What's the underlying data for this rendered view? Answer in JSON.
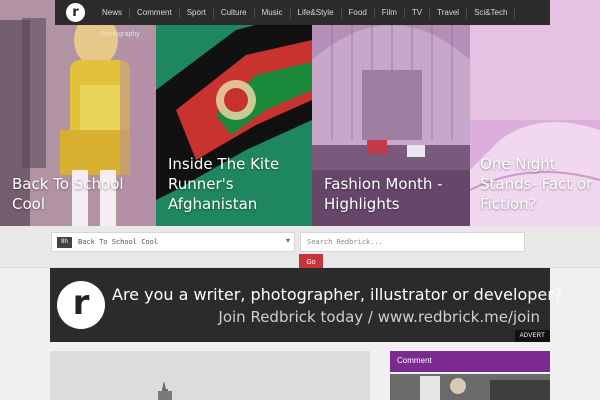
{
  "nav": {
    "logo_letter": "r",
    "items": [
      "News",
      "Comment",
      "Sport",
      "Culture",
      "Music",
      "Life&Style",
      "Food",
      "Film",
      "TV",
      "Travel",
      "Sci&Tech"
    ]
  },
  "hero": [
    {
      "title": "Back To School Cool",
      "tag": "Photography"
    },
    {
      "title": "Inside The Kite Runner's Afghanistan"
    },
    {
      "title": "Fashion Month - Highlights"
    },
    {
      "title": "One Night Stands- Fact or Fiction?"
    }
  ],
  "toolbar": {
    "select_badge": "8h",
    "select_value": "Back To School Cool",
    "search_placeholder": "Search Redbrick...",
    "go_label": "Go"
  },
  "ad": {
    "logo_letter": "r",
    "line1": "Are you a writer, photographer, illustrator or developer?",
    "line2": "Join Redbrick today / www.redbrick.me/join",
    "advert_label": "ADVERT"
  },
  "sidebar": {
    "heading": "Comment"
  },
  "colors": {
    "nav_bg": "#2b2b2b",
    "accent_red": "#c7343a",
    "comment_purple": "#7b2b8f"
  }
}
